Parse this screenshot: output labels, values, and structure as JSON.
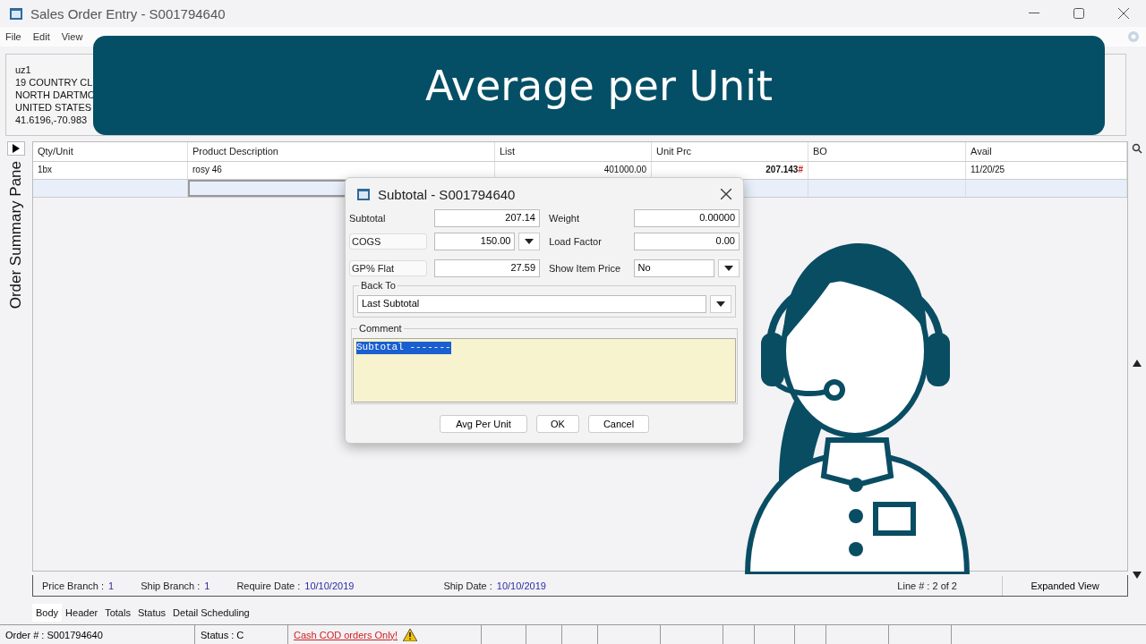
{
  "window": {
    "title": "Sales Order Entry - S001794640"
  },
  "menu": [
    "File",
    "Edit",
    "View"
  ],
  "address": [
    "uz1",
    "19 COUNTRY CL",
    "NORTH DARTMO",
    "UNITED STATES",
    "41.6196,-70.983"
  ],
  "banner": {
    "title": "Average per Unit"
  },
  "side_pane": {
    "label": "Order Summary Pane"
  },
  "table": {
    "columns": [
      "Qty/Unit",
      "Product Description",
      "List",
      "Unit Prc",
      "BO",
      "Avail"
    ],
    "rows": [
      {
        "selected": false,
        "cells": [
          "1bx",
          "rosy 46",
          "401000.00",
          "207.143",
          "",
          "11/20/25"
        ],
        "flag": "#"
      },
      {
        "selected": true,
        "cells": [
          "",
          "",
          "",
          "",
          "",
          ""
        ]
      }
    ]
  },
  "info_bar": [
    {
      "label": "Price Branch :",
      "value": "1"
    },
    {
      "label": "Ship Branch :",
      "value": "1"
    },
    {
      "label": "Require Date :",
      "value": "10/10/2019"
    },
    {
      "label": "Ship Date :",
      "value": "10/10/2019"
    }
  ],
  "line_info": "Line # :  2 of 2",
  "expanded_view": "Expanded View",
  "tabs": [
    {
      "label": "Body",
      "selected": true
    },
    {
      "label": "Header",
      "selected": false
    },
    {
      "label": "Totals",
      "selected": false
    },
    {
      "label": "Status",
      "selected": false
    },
    {
      "label": "Detail Scheduling",
      "selected": false
    }
  ],
  "status_bar": {
    "order": "Order # :   S001794640",
    "status": "Status :    C",
    "warning": "Cash COD orders Only!"
  },
  "dialog": {
    "title": "Subtotal - S001794640",
    "subtotal": {
      "label": "Subtotal",
      "value": "207.14"
    },
    "cogs": {
      "label": "COGS",
      "value": "150.00"
    },
    "gp": {
      "label": "GP% Flat",
      "value": "27.59"
    },
    "weight": {
      "label": "Weight",
      "value": "0.00000"
    },
    "load_factor": {
      "label": "Load Factor",
      "value": "0.00"
    },
    "show_item_price": {
      "label": "Show Item Price",
      "value": "No"
    },
    "back_to": {
      "label": "Back To",
      "value": "Last Subtotal"
    },
    "comment": {
      "label": "Comment",
      "value": "Subtotal -------"
    },
    "buttons": [
      "Avg Per Unit",
      "OK",
      "Cancel"
    ]
  }
}
